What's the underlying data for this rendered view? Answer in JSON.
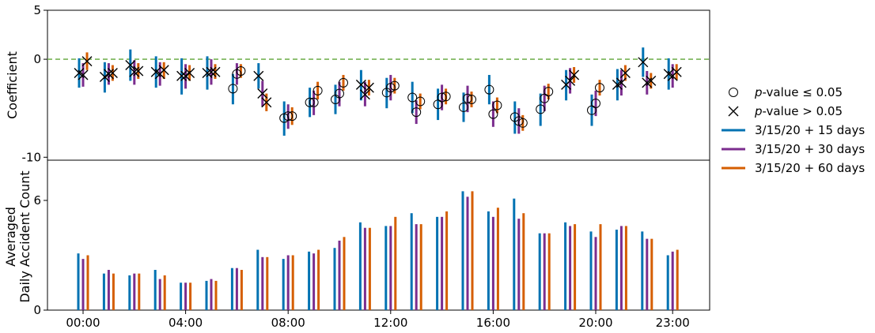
{
  "chart_data": [
    {
      "type": "errorbar",
      "ylabel": "Coefficient",
      "ylim": [
        -10.3,
        5
      ],
      "yticks": [
        5,
        0,
        -10
      ],
      "reference_line": 0,
      "hours": [
        0,
        1,
        2,
        3,
        4,
        5,
        6,
        7,
        8,
        9,
        10,
        11,
        12,
        13,
        14,
        15,
        16,
        17,
        18,
        19,
        20,
        21,
        22,
        23
      ],
      "series": [
        {
          "name": "3/15/20 + 15 days",
          "color": "#0072B2",
          "values": [
            -1.4,
            -1.8,
            -0.6,
            -1.3,
            -1.7,
            -1.4,
            -3.0,
            -1.7,
            -6.0,
            -4.4,
            -4.1,
            -2.6,
            -3.4,
            -3.9,
            -4.6,
            -4.9,
            -3.1,
            -5.9,
            -5.1,
            -2.6,
            -5.2,
            -2.6,
            -0.3,
            -1.5
          ],
          "lower": [
            -2.9,
            -3.4,
            -2.2,
            -2.9,
            -3.6,
            -3.1,
            -4.6,
            -3.0,
            -7.8,
            -5.9,
            -5.6,
            -4.2,
            -5.0,
            -5.5,
            -6.2,
            -6.4,
            -4.6,
            -7.6,
            -6.8,
            -4.2,
            -6.8,
            -4.2,
            -1.8,
            -3.1
          ],
          "upper": [
            0.1,
            -0.3,
            1.0,
            0.3,
            0.1,
            0.3,
            -1.5,
            -0.4,
            -4.3,
            -2.9,
            -2.6,
            -1.1,
            -1.9,
            -2.3,
            -3.0,
            -3.4,
            -1.6,
            -4.3,
            -3.5,
            -1.1,
            -3.6,
            -1.0,
            1.2,
            0.1
          ],
          "significant": [
            false,
            false,
            false,
            false,
            false,
            false,
            true,
            false,
            true,
            true,
            true,
            false,
            true,
            true,
            true,
            true,
            true,
            true,
            true,
            false,
            true,
            false,
            false,
            false
          ]
        },
        {
          "name": "3/15/20 + 30 days",
          "color": "#7B2D8E",
          "values": [
            -1.6,
            -1.5,
            -1.3,
            -1.5,
            -1.7,
            -1.3,
            -1.5,
            -3.5,
            -5.8,
            -4.4,
            -3.5,
            -3.6,
            -2.9,
            -5.4,
            -3.9,
            -4.0,
            -5.6,
            -6.3,
            -4.0,
            -2.2,
            -4.5,
            -2.4,
            -2.4,
            -1.7
          ],
          "lower": [
            -2.8,
            -2.6,
            -2.6,
            -2.7,
            -3.0,
            -2.6,
            -2.6,
            -4.8,
            -7.1,
            -5.7,
            -4.8,
            -4.8,
            -4.2,
            -6.6,
            -5.2,
            -5.4,
            -6.9,
            -7.6,
            -5.3,
            -3.5,
            -5.8,
            -3.7,
            -3.6,
            -2.9
          ],
          "upper": [
            -0.4,
            -0.4,
            -0.1,
            -0.3,
            -0.5,
            0.0,
            -0.4,
            -2.2,
            -4.6,
            -3.2,
            -2.3,
            -2.3,
            -1.6,
            -4.2,
            -2.6,
            -2.7,
            -4.3,
            -5.0,
            -2.7,
            -0.9,
            -3.2,
            -1.1,
            -1.2,
            -0.5
          ]
        },
        {
          "name": "3/15/20 + 60 days",
          "color": "#D55E00",
          "values": [
            -0.2,
            -1.4,
            -1.2,
            -1.1,
            -1.4,
            -1.3,
            -1.2,
            -4.4,
            -5.8,
            -3.2,
            -2.4,
            -2.9,
            -2.7,
            -4.3,
            -3.8,
            -4.1,
            -4.7,
            -6.5,
            -3.3,
            -1.6,
            -2.9,
            -1.4,
            -2.2,
            -1.3
          ],
          "lower": [
            -1.1,
            -2.2,
            -2.0,
            -2.0,
            -2.2,
            -2.0,
            -1.9,
            -5.3,
            -6.7,
            -4.1,
            -3.2,
            -3.7,
            -3.5,
            -5.1,
            -4.6,
            -4.9,
            -5.5,
            -7.3,
            -4.1,
            -2.4,
            -3.7,
            -2.2,
            -3.0,
            -2.1
          ],
          "upper": [
            0.7,
            -0.6,
            -0.4,
            -0.3,
            -0.6,
            -0.5,
            -0.5,
            -3.5,
            -4.9,
            -2.3,
            -1.6,
            -2.1,
            -1.9,
            -3.5,
            -3.0,
            -3.3,
            -3.9,
            -5.7,
            -2.5,
            -0.8,
            -2.1,
            -0.6,
            -1.4,
            -0.5
          ]
        }
      ]
    },
    {
      "type": "bar",
      "ylabel": "Averaged Daily Accident Count",
      "ylabel_lines": [
        "Averaged",
        "Daily Accident Count"
      ],
      "ylim": [
        0,
        8.2
      ],
      "yticks": [
        0,
        6
      ],
      "hours": [
        0,
        1,
        2,
        3,
        4,
        5,
        6,
        7,
        8,
        9,
        10,
        11,
        12,
        13,
        14,
        15,
        16,
        17,
        18,
        19,
        20,
        21,
        22,
        23
      ],
      "categories": [
        "00:00",
        "04:00",
        "08:00",
        "12:00",
        "16:00",
        "20:00",
        "23:00"
      ],
      "category_hours": [
        0,
        4,
        8,
        12,
        16,
        20,
        23
      ],
      "series": [
        {
          "name": "3/15/20 + 15 days",
          "color": "#0072B2",
          "values": [
            3.1,
            2.0,
            1.9,
            2.2,
            1.5,
            1.6,
            2.3,
            3.3,
            2.8,
            3.2,
            3.4,
            4.8,
            4.6,
            5.3,
            5.1,
            6.5,
            5.4,
            6.1,
            4.2,
            4.8,
            4.3,
            4.4,
            4.3,
            3.0
          ]
        },
        {
          "name": "3/15/20 + 30 days",
          "color": "#7B2D8E",
          "values": [
            2.8,
            2.2,
            2.0,
            1.7,
            1.5,
            1.7,
            2.3,
            2.9,
            3.0,
            3.1,
            3.8,
            4.5,
            4.6,
            4.7,
            5.1,
            6.2,
            5.1,
            5.0,
            4.2,
            4.6,
            4.0,
            4.6,
            3.9,
            3.2
          ]
        },
        {
          "name": "3/15/20 + 60 days",
          "color": "#D55E00",
          "values": [
            3.0,
            2.0,
            2.0,
            1.9,
            1.5,
            1.6,
            2.2,
            2.9,
            3.0,
            3.3,
            4.0,
            4.5,
            5.1,
            4.7,
            5.4,
            6.5,
            5.6,
            5.3,
            4.2,
            4.7,
            4.7,
            4.6,
            3.9,
            3.3
          ]
        }
      ]
    }
  ],
  "legend": {
    "placement": "right",
    "entries": [
      {
        "marker": "circle",
        "prefix": "p",
        "label": "-value  ≤  0.05"
      },
      {
        "marker": "cross",
        "prefix": "p",
        "label": "-value  >  0.05"
      },
      {
        "marker": "line",
        "color": "#0072B2",
        "label": "3/15/20 + 15 days"
      },
      {
        "marker": "line",
        "color": "#7B2D8E",
        "label": "3/15/20 + 30 days"
      },
      {
        "marker": "line",
        "color": "#D55E00",
        "label": "3/15/20 + 60 days"
      }
    ]
  },
  "colors": {
    "reference_line": "#77B255",
    "axes": "#000000"
  }
}
